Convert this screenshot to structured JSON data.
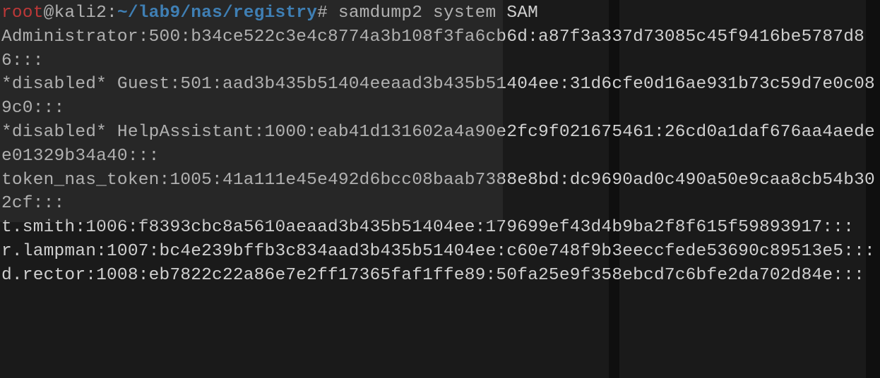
{
  "prompt": {
    "user": "root",
    "at": "@",
    "host": "kali2",
    "colon": ":",
    "path": "~/lab9/nas/registry",
    "end": "# "
  },
  "command": "samdump2 system SAM",
  "output": "Administrator:500:b34ce522c3e4c8774a3b108f3fa6cb6d:a87f3a337d73085c45f9416be5787d86:::\n*disabled* Guest:501:aad3b435b51404eeaad3b435b51404ee:31d6cfe0d16ae931b73c59d7e0c089c0:::\n*disabled* HelpAssistant:1000:eab41d131602a4a90e2fc9f021675461:26cd0a1daf676aa4aedee01329b34a40:::\ntoken_nas_token:1005:41a111e45e492d6bcc08baab7388e8bd:dc9690ad0c490a50e9caa8cb54b302cf:::\nt.smith:1006:f8393cbc8a5610aeaad3b435b51404ee:179699ef43d4b9ba2f8f615f59893917:::\nr.lampman:1007:bc4e239bffb3c834aad3b435b51404ee:c60e748f9b3eeccfede53690c89513e5:::\nd.rector:1008:eb7822c22a86e7e2ff17365faf1ffe89:50fa25e9f358ebcd7c6bfe2da702d84e:::"
}
